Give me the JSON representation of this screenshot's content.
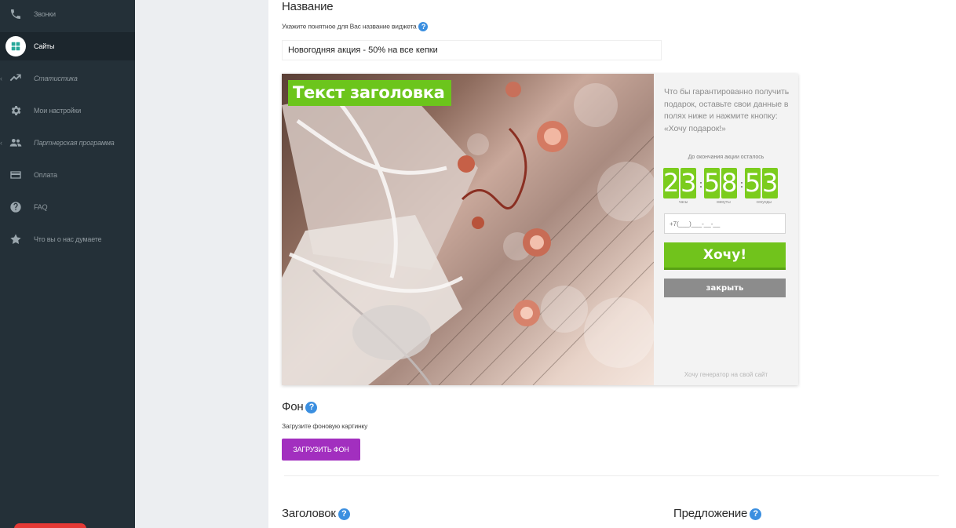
{
  "sidebar": {
    "items": [
      {
        "label": "Звонки",
        "icon": "phone-icon"
      },
      {
        "label": "Сайты",
        "icon": "grid-icon"
      },
      {
        "label": "Статистика",
        "icon": "chart-line-icon"
      },
      {
        "label": "Мои настройки",
        "icon": "gear-icon"
      },
      {
        "label": "Партнерская программа",
        "icon": "users-icon"
      },
      {
        "label": "Оплата",
        "icon": "credit-card-icon"
      },
      {
        "label": "FAQ",
        "icon": "question-icon"
      },
      {
        "label": "Что вы о нас думаете",
        "icon": "star-icon"
      }
    ]
  },
  "name_section": {
    "title": "Название",
    "hint": "Укажите понятное для Вас название виджета",
    "value": "Новогодняя акция - 50% на все кепки"
  },
  "widget": {
    "headline": "Текст заголовка",
    "offer_text": "Что бы гарантированно получить подарок, оставьте свои данные в полях ниже и нажмите кнопку: «Хочу подарок!»",
    "countdown_label": "До окончания акции осталось",
    "countdown": {
      "hours": [
        "2",
        "3"
      ],
      "minutes": [
        "5",
        "8"
      ],
      "seconds": [
        "5",
        "3"
      ]
    },
    "units": {
      "hours": "часы",
      "minutes": "минуты",
      "seconds": "секунды"
    },
    "phone_placeholder": "+7(___)___-__-__",
    "want_button": "Хочу!",
    "close_button": "закрыть",
    "generator_link": "Хочу генератор на свой сайт",
    "accent_color": "#71c31c"
  },
  "background_section": {
    "title": "Фон",
    "hint": "Загрузите фоновую картинку",
    "upload_button": "ЗАГРУЗИТЬ ФОН"
  },
  "bottom": {
    "heading_label": "Заголовок",
    "offer_label": "Предложение"
  },
  "colors": {
    "sidebar": "#243038",
    "upload_button": "#a22fbf",
    "help_icon": "#3b8fe0"
  }
}
